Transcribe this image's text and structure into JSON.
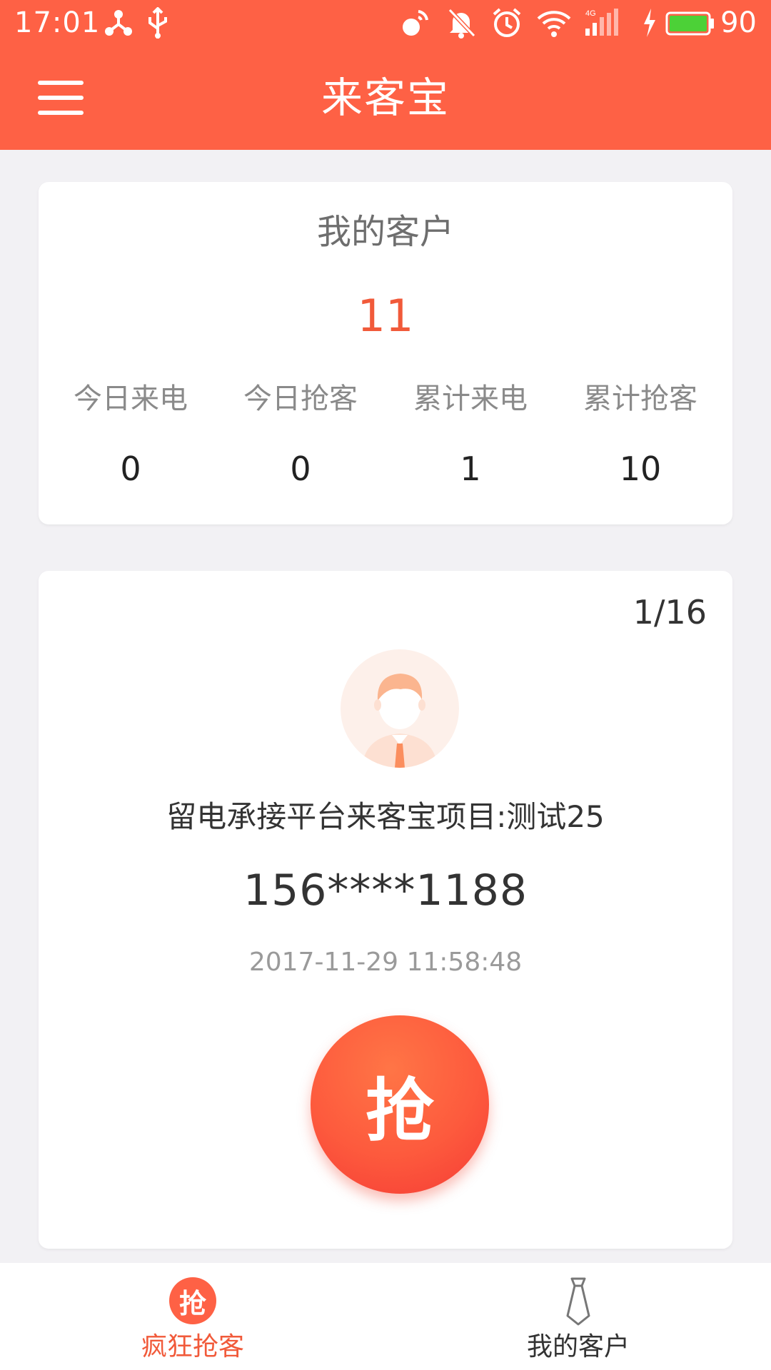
{
  "status_bar": {
    "time": "17:01",
    "battery": "90",
    "icons": [
      "share-icon",
      "usb-icon",
      "signal-icon",
      "mute-icon",
      "alarm-icon",
      "wifi-icon",
      "cell-signal-icon",
      "charging-icon",
      "battery-icon"
    ],
    "battery_color": "#4cd137"
  },
  "app_bar": {
    "title": "来客宝",
    "menu_icon": "hamburger-menu-icon",
    "color": "#fe6145"
  },
  "summary": {
    "title": "我的客户",
    "total": "11",
    "stats": [
      {
        "label": "今日来电",
        "value": "0"
      },
      {
        "label": "今日抢客",
        "value": "0"
      },
      {
        "label": "累计来电",
        "value": "1"
      },
      {
        "label": "累计抢客",
        "value": "10"
      }
    ]
  },
  "lead": {
    "pager": "1/16",
    "avatar_icon": "customer-avatar-icon",
    "name": "留电承接平台来客宝项目:测试25",
    "phone": "156****1188",
    "time": "2017-11-29 11:58:48",
    "grab_label": "抢"
  },
  "bottom_nav": {
    "items": [
      {
        "label": "疯狂抢客",
        "icon": "grab-icon",
        "badge": "抢",
        "active": true
      },
      {
        "label": "我的客户",
        "icon": "tie-icon",
        "active": false
      }
    ],
    "active_color": "#f15a3a"
  }
}
